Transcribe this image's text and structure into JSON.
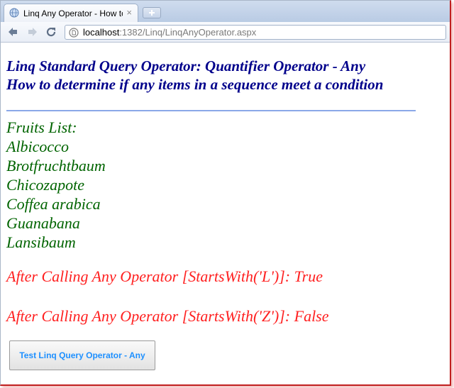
{
  "browser": {
    "tab": {
      "title": "Linq Any Operator - How to",
      "close_glyph": "×"
    },
    "address": {
      "host": "localhost",
      "path": ":1382/Linq/LinqAnyOperator.aspx"
    }
  },
  "page": {
    "heading_line1": "Linq Standard Query Operator: Quantifier Operator - Any",
    "heading_line2": "How to determine if any items in a sequence meet a condition",
    "fruits_label": "Fruits List:",
    "fruits": [
      "Albicocco",
      "Brotfruchtbaum",
      "Chicozapote",
      "Coffea arabica",
      "Guanabana",
      "Lansibaum"
    ],
    "result_l": "After Calling Any Operator [StartsWith('L')]: True",
    "result_z": "After Calling Any Operator [StartsWith('Z')]: False",
    "button_label": "Test Linq Query Operator - Any"
  },
  "colors": {
    "heading": "#00008b",
    "fruits": "#006400",
    "result": "#ff2020",
    "button_text": "#1e90ff",
    "rule": "#8aa8e8"
  },
  "icons": {
    "favicon": "globe-icon",
    "back": "back-arrow-icon",
    "forward": "forward-arrow-icon",
    "reload": "reload-icon",
    "page": "page-icon",
    "new_tab": "plus-icon"
  }
}
